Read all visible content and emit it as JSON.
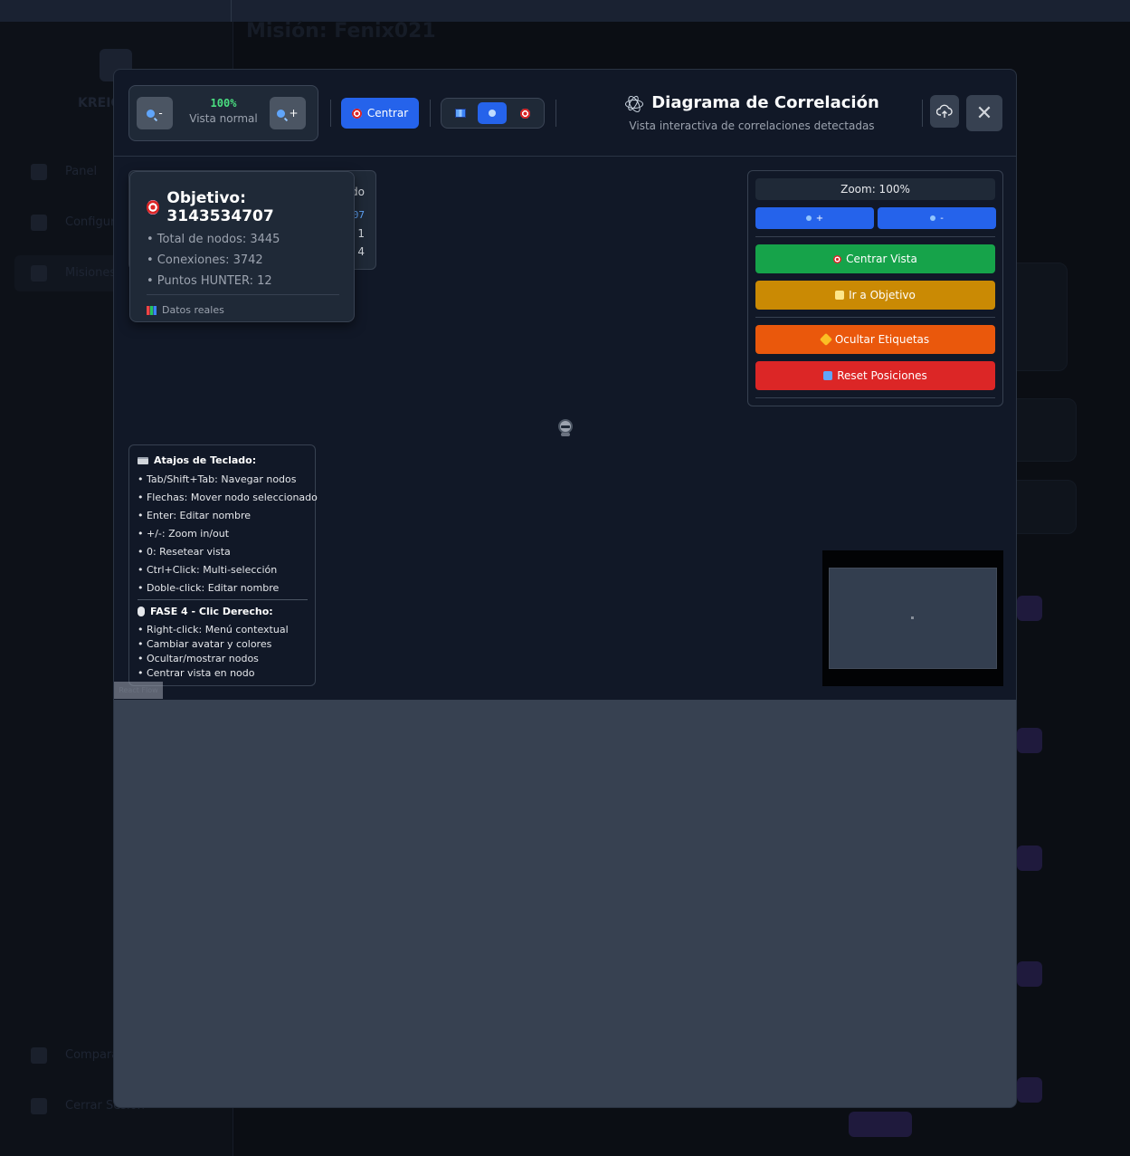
{
  "background": {
    "brand": "KREIO",
    "page_title": "Misión: Fenix021",
    "nav_items": [
      "Panel",
      "Configuración",
      "Misiones",
      "Comparar",
      "Cerrar Sesión"
    ]
  },
  "toolbar": {
    "zoom_out_label": "-",
    "zoom_in_label": "+",
    "zoom_percent": "100%",
    "zoom_mode_label": "Vista normal",
    "center_label": "Centrar",
    "view_modes": [
      "map",
      "search",
      "target"
    ],
    "active_view_mode": "search"
  },
  "header": {
    "title": "Diagrama de Correlación",
    "subtitle": "Vista interactiva de correlaciones detectadas",
    "export_icon": "cloud-upload-icon",
    "close_icon": "close-icon"
  },
  "info_card": {
    "title": "Objetivo: 3143534707",
    "lines": [
      "• Total de nodos: 3445",
      "• Conexiones: 3742",
      "• Puntos HUNTER: 12"
    ],
    "footer": "Datos reales",
    "underlay_fragments": [
      "do",
      "07",
      "1",
      "4"
    ]
  },
  "controls": {
    "zoom_label": "Zoom: 100%",
    "zoom_in": "+",
    "zoom_out": "-",
    "center_view": "Centrar Vista",
    "go_target": "Ir a Objetivo",
    "hide_labels": "Ocultar Etiquetas",
    "reset_positions": "Reset Posiciones",
    "colors": {
      "zoom": "#2563eb",
      "center": "#16a34a",
      "target": "#ca8a04",
      "labels": "#ea580c",
      "reset": "#dc2626"
    }
  },
  "shortcuts": {
    "title": "Atajos de Teclado:",
    "items": [
      "• Tab/Shift+Tab: Navegar nodos",
      "• Flechas: Mover nodo seleccionado",
      "• Enter: Editar nombre",
      "• +/-: Zoom in/out",
      "• 0: Resetear vista",
      "• Ctrl+Click: Multi-selección",
      "• Doble-click: Editar nombre"
    ],
    "phase_title": "FASE 4 - Clic Derecho:",
    "phase_items": [
      "• Right-click: Menú contextual",
      "• Cambiar avatar y colores",
      "• Ocultar/mostrar nodos",
      "• Centrar vista en nodo"
    ]
  },
  "attribution": "React Flow",
  "nodes": [
    {
      "icon": "robot-icon"
    }
  ]
}
